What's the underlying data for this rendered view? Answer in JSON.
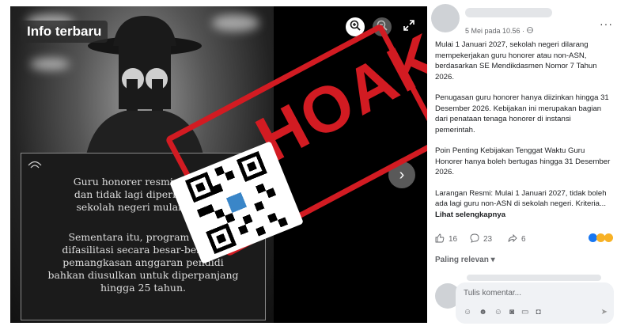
{
  "image": {
    "badge": "Info terbaru",
    "overlay_lines": [
      "Guru honorer resmi akan di",
      "dan tidak lagi diperbolehka",
      "sekolah negeri mulai 1 Jan",
      "Sementara itu, program MBG",
      "difasilitasi secara besar-besaran",
      "pemangkasan anggaran pendidi",
      "bahkan diusulkan untuk diperpanjang",
      "hingga 25 tahun."
    ],
    "stamp_text": "HOAKS"
  },
  "post": {
    "meta": "5 Mei pada 10.56 · ",
    "paragraphs": [
      "Mulai 1 Januari 2027, sekolah negeri dilarang mempekerjakan guru honorer atau non-ASN, berdasarkan SE Mendikdasmen Nomor 7 Tahun 2026.",
      "Penugasan guru honorer hanya diizinkan hingga 31 Desember 2026. Kebijakan ini merupakan bagian dari penataan tenaga honorer di instansi pemerintah.",
      "Poin Penting Kebijakan Tenggat Waktu Guru Honorer hanya boleh bertugas hingga 31 Desember 2026."
    ],
    "last_paragraph": "Larangan Resmi: Mulai 1 Januari 2027, tidak boleh ada lagi guru non-ASN di sekolah negeri. Kriteria... ",
    "see_more": "Lihat selengkapnya",
    "likes": "16",
    "comments": "23",
    "shares": "6",
    "sort_label": "Paling relevan",
    "comment_placeholder": "Tulis komentar..."
  },
  "colors": {
    "stamp_red": "#d21b22",
    "meta_grey": "#65676b"
  }
}
